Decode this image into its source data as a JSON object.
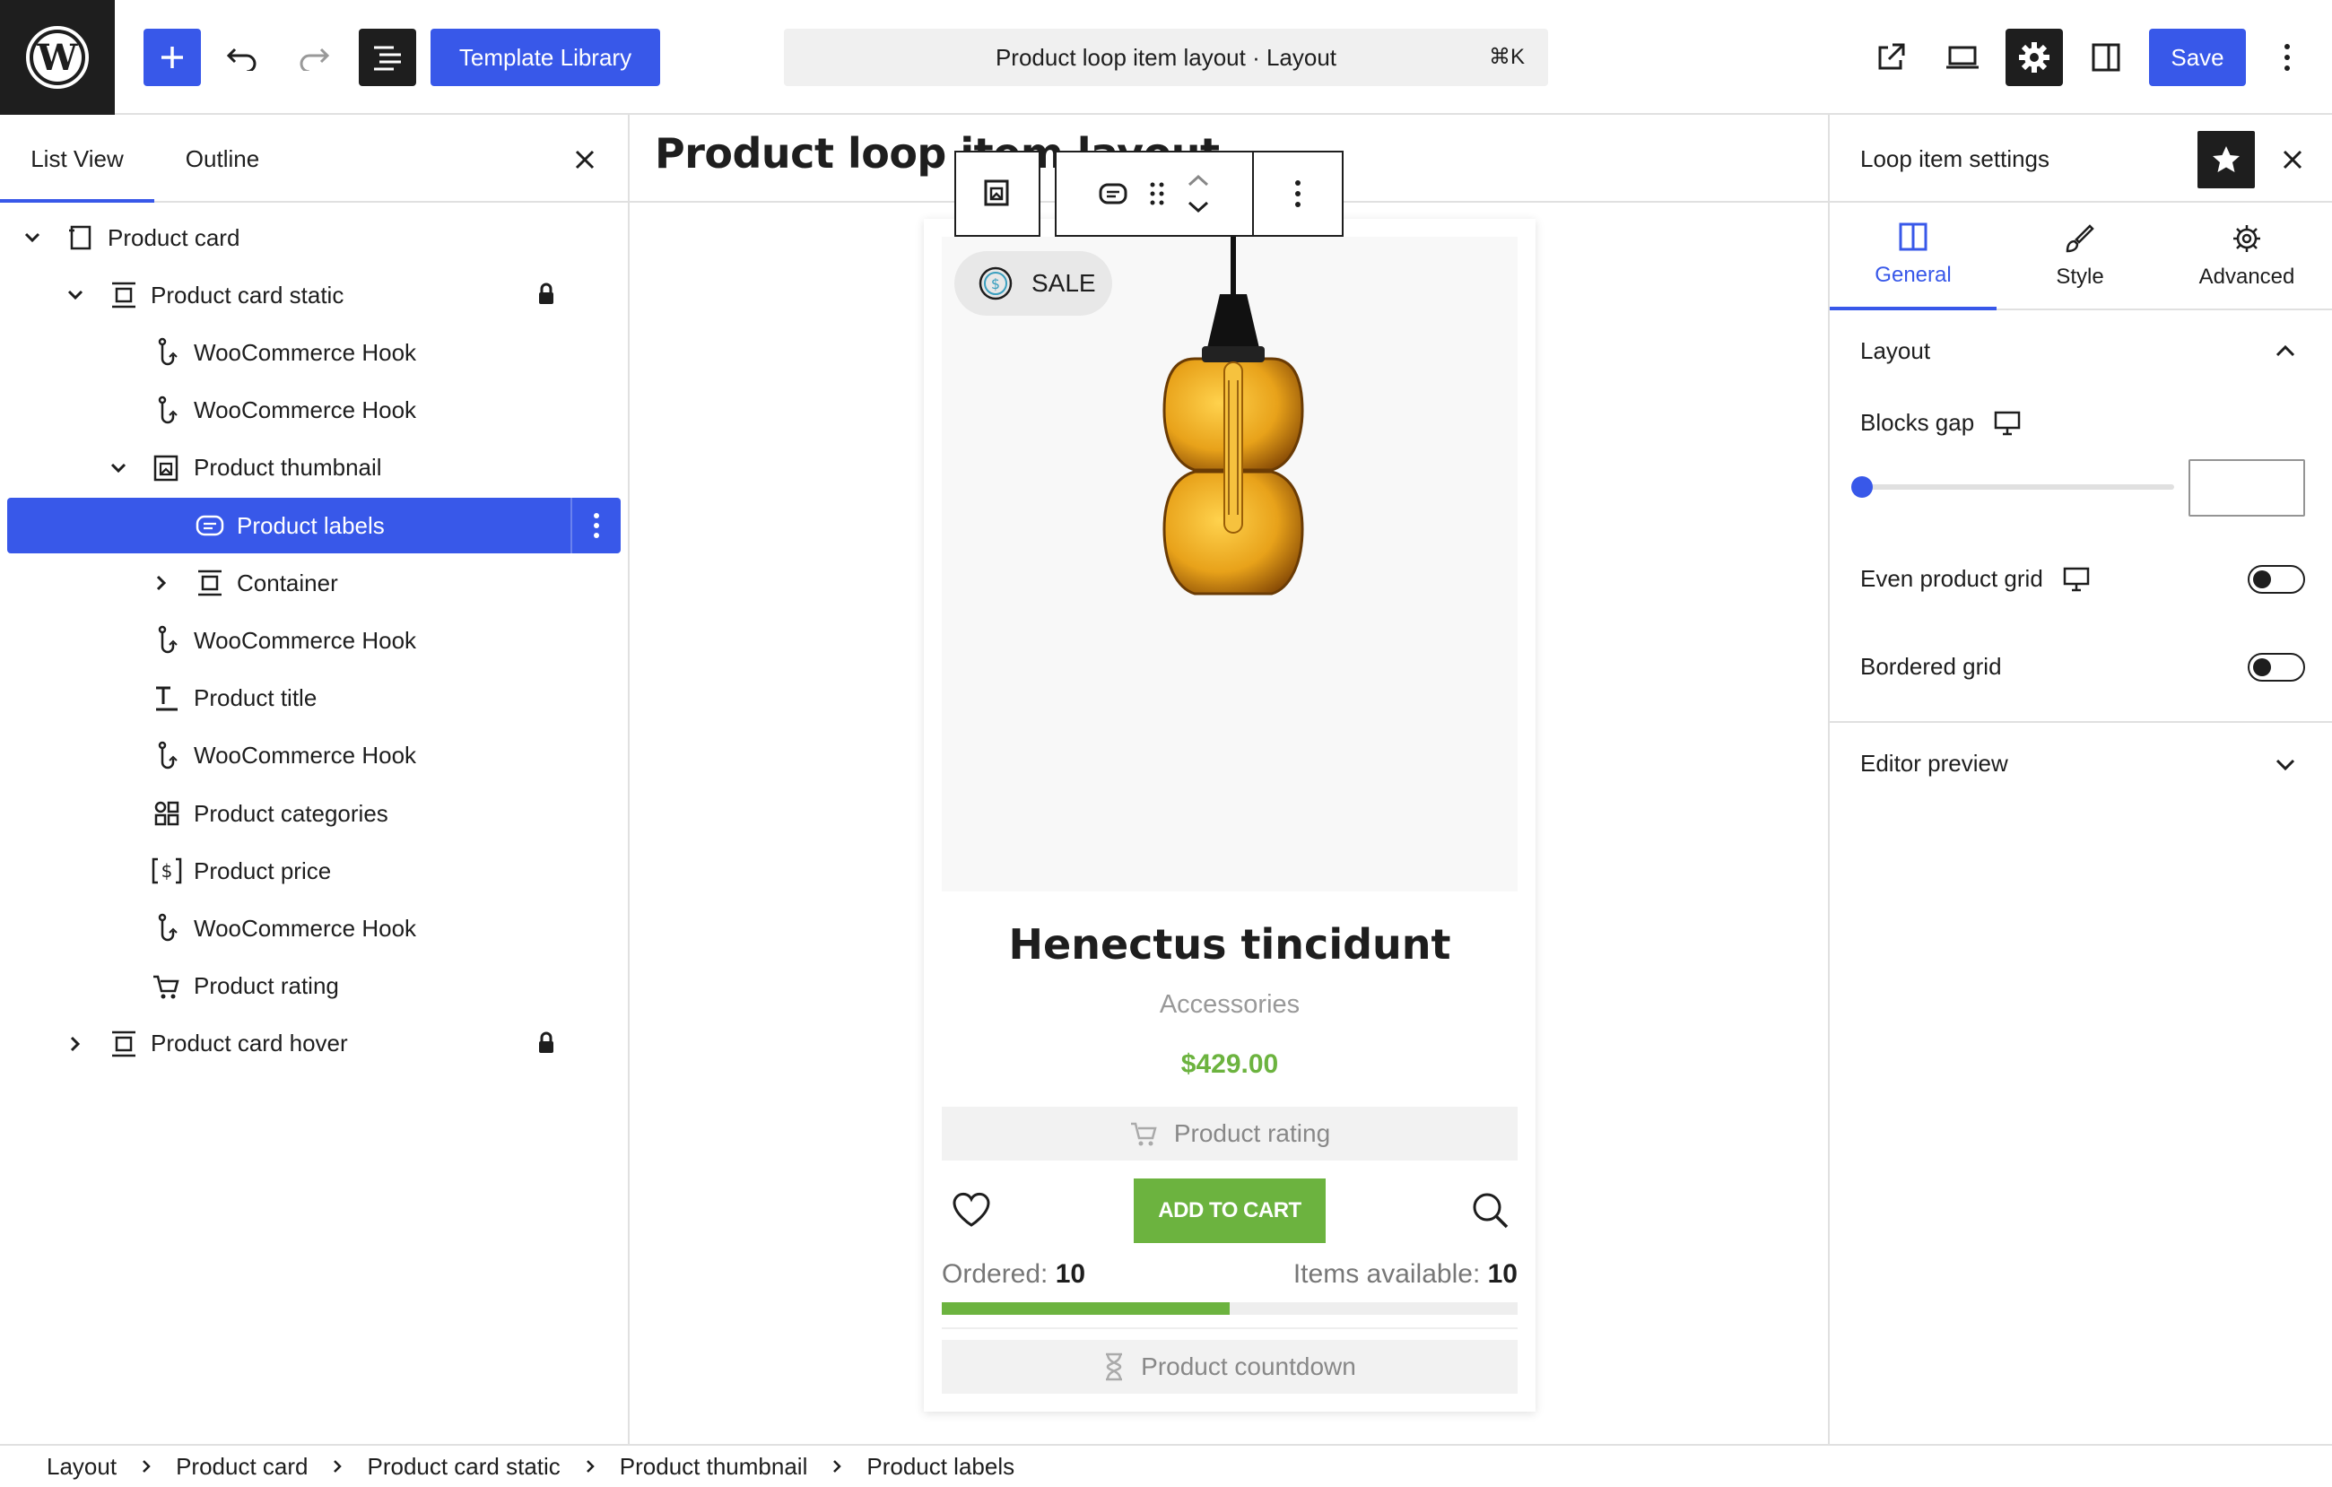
{
  "topbar": {
    "template_library_label": "Template Library",
    "command_text": "Product loop item layout · Layout",
    "command_shortcut": "⌘K",
    "save_label": "Save"
  },
  "left_panel": {
    "tabs": [
      "List View",
      "Outline"
    ],
    "active_tab": "List View",
    "tree": [
      {
        "label": "Product card",
        "depth": 0,
        "expander": "open",
        "icon": "product-card-icon"
      },
      {
        "label": "Product card static",
        "depth": 1,
        "expander": "open",
        "icon": "container-icon",
        "locked": true
      },
      {
        "label": "WooCommerce Hook",
        "depth": 2,
        "icon": "hook-icon"
      },
      {
        "label": "WooCommerce Hook",
        "depth": 2,
        "icon": "hook-icon"
      },
      {
        "label": "Product thumbnail",
        "depth": 2,
        "expander": "open",
        "icon": "thumbnail-icon"
      },
      {
        "label": "Product labels",
        "depth": 3,
        "icon": "labels-icon",
        "selected": true
      },
      {
        "label": "Container",
        "depth": 3,
        "expander": "closed",
        "icon": "container-icon"
      },
      {
        "label": "WooCommerce Hook",
        "depth": 2,
        "icon": "hook-icon"
      },
      {
        "label": "Product title",
        "depth": 2,
        "icon": "title-icon"
      },
      {
        "label": "WooCommerce Hook",
        "depth": 2,
        "icon": "hook-icon"
      },
      {
        "label": "Product categories",
        "depth": 2,
        "icon": "categories-icon"
      },
      {
        "label": "Product price",
        "depth": 2,
        "icon": "price-icon"
      },
      {
        "label": "WooCommerce Hook",
        "depth": 2,
        "icon": "hook-icon"
      },
      {
        "label": "Product rating",
        "depth": 2,
        "icon": "rating-icon"
      },
      {
        "label": "Product card hover",
        "depth": 1,
        "expander": "closed",
        "icon": "container-icon",
        "locked": true
      }
    ]
  },
  "canvas": {
    "title": "Product loop item layout",
    "card": {
      "sale_label": "SALE",
      "product_name": "Henectus tincidunt",
      "category": "Accessories",
      "price": "$429.00",
      "rating_placeholder": "Product rating",
      "add_to_cart": "ADD TO CART",
      "ordered_label": "Ordered:",
      "ordered_value": "10",
      "available_label": "Items available:",
      "available_value": "10",
      "stock_progress": 0.5,
      "countdown_placeholder": "Product countdown"
    }
  },
  "right_panel": {
    "title": "Loop item settings",
    "tabs": [
      "General",
      "Style",
      "Advanced"
    ],
    "active_tab": "General",
    "layout_section": "Layout",
    "blocks_gap_label": "Blocks gap",
    "blocks_gap_value": "",
    "even_grid_label": "Even product grid",
    "even_grid_on": false,
    "bordered_grid_label": "Bordered grid",
    "bordered_grid_on": false,
    "editor_preview_label": "Editor preview"
  },
  "breadcrumb": [
    "Layout",
    "Product card",
    "Product card static",
    "Product thumbnail",
    "Product labels"
  ],
  "colors": {
    "accent": "#3858e9",
    "dark": "#1e1e1e",
    "price_green": "#6cb33f",
    "border": "#e0e0e0"
  }
}
